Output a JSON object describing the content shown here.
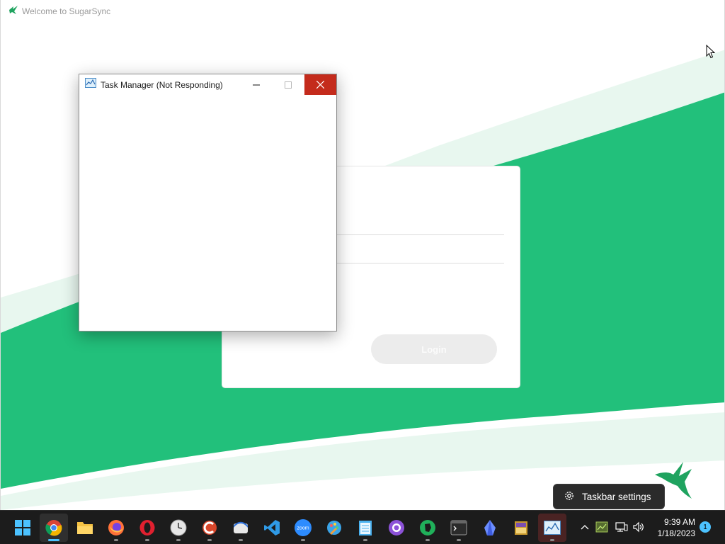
{
  "app": {
    "title": "Welcome to SugarSync",
    "accent": "#1fbf72",
    "login_label": "Login"
  },
  "task_manager": {
    "title": "Task Manager (Not Responding)"
  },
  "tooltip": {
    "label": "Taskbar settings"
  },
  "taskbar": {
    "apps": [
      {
        "name": "start-icon",
        "pinned": true
      },
      {
        "name": "chrome-icon",
        "active": true
      },
      {
        "name": "file-explorer-icon"
      },
      {
        "name": "firefox-icon"
      },
      {
        "name": "opera-icon"
      },
      {
        "name": "clock-app-icon"
      },
      {
        "name": "ccleaner-icon"
      },
      {
        "name": "disk-app-icon"
      },
      {
        "name": "vscode-icon"
      },
      {
        "name": "zoom-icon",
        "text": "zoom"
      },
      {
        "name": "paint-icon"
      },
      {
        "name": "notepad-icon"
      },
      {
        "name": "github-icon"
      },
      {
        "name": "evernote-icon"
      },
      {
        "name": "terminal-icon"
      },
      {
        "name": "crystal-app-icon"
      },
      {
        "name": "winrar-icon"
      },
      {
        "name": "task-manager-icon",
        "open": true
      }
    ],
    "clock": {
      "time": "9:39 AM",
      "date": "1/18/2023"
    },
    "notification_count": "1"
  }
}
